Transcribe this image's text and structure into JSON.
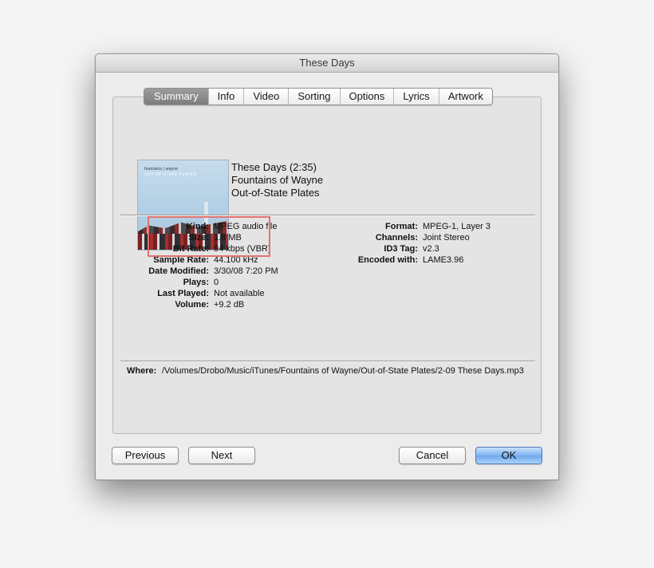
{
  "window": {
    "title": "These Days"
  },
  "tabs": [
    {
      "label": "Summary",
      "active": true
    },
    {
      "label": "Info",
      "active": false
    },
    {
      "label": "Video",
      "active": false
    },
    {
      "label": "Sorting",
      "active": false
    },
    {
      "label": "Options",
      "active": false
    },
    {
      "label": "Lyrics",
      "active": false
    },
    {
      "label": "Artwork",
      "active": false
    }
  ],
  "album_art": {
    "band_text": "fountains | wayne",
    "album_text": "OUT-OF-STATE PLATES"
  },
  "track": {
    "title_line": "These Days (2:35)",
    "artist": "Fountains of Wayne",
    "album": "Out-of-State Plates"
  },
  "info_left": [
    {
      "label": "Kind:",
      "value": "MPEG audio file"
    },
    {
      "label": "Size:",
      "value": "1.8 MB"
    },
    {
      "label": "Bit Rate:",
      "value": "94 kbps (VBR)"
    },
    {
      "label": "Sample Rate:",
      "value": "44.100 kHz"
    },
    {
      "label": "Date Modified:",
      "value": "3/30/08 7:20 PM"
    },
    {
      "label": "Plays:",
      "value": "0"
    },
    {
      "label": "Last Played:",
      "value": "Not available"
    },
    {
      "label": "Volume:",
      "value": "+9.2 dB"
    }
  ],
  "info_right": [
    {
      "label": "Format:",
      "value": "MPEG-1, Layer 3"
    },
    {
      "label": "Channels:",
      "value": "Joint Stereo"
    },
    {
      "label": "ID3 Tag:",
      "value": "v2.3"
    },
    {
      "label": "Encoded with:",
      "value": "LAME3.96"
    }
  ],
  "where": {
    "label": "Where:",
    "value": "/Volumes/Drobo/Music/iTunes/Fountains of Wayne/Out-of-State Plates/2-09 These Days.mp3"
  },
  "buttons": {
    "previous": "Previous",
    "next": "Next",
    "cancel": "Cancel",
    "ok": "OK"
  },
  "colors": {
    "highlight_box": "#e0726e",
    "ok_button": "#7fb4f0",
    "active_tab": "#8a8a8a"
  }
}
